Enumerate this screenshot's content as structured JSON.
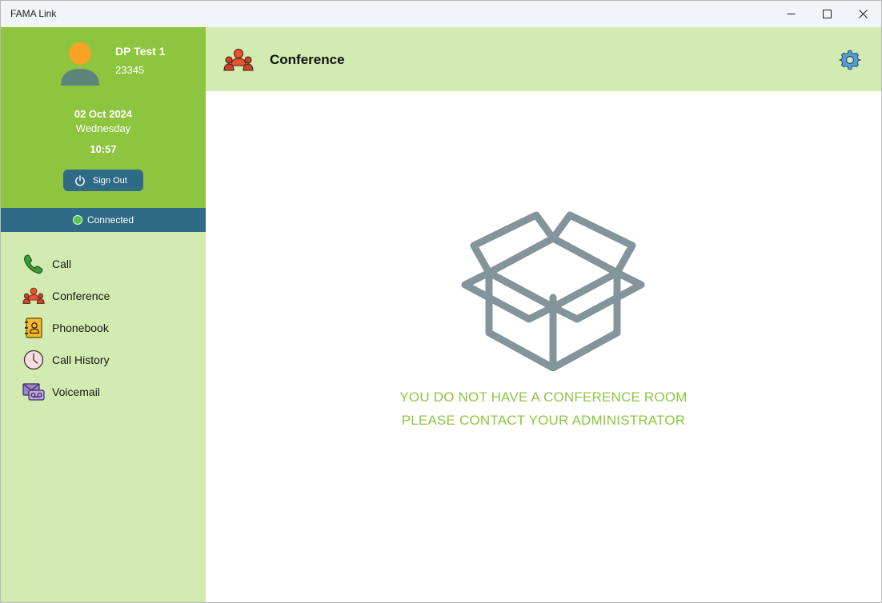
{
  "window": {
    "title": "FAMA Link"
  },
  "colors": {
    "accent_green": "#8dc53f",
    "panel_green": "#d1ebb0",
    "status_blue": "#2f6b87",
    "connected": "#52c64a"
  },
  "user": {
    "name": "DP Test 1",
    "extension": "23345"
  },
  "clock": {
    "date": "02 Oct 2024",
    "weekday": "Wednesday",
    "time": "10:57"
  },
  "signout": {
    "label": "Sign Out",
    "icon": "power-icon"
  },
  "status": {
    "label": "Connected"
  },
  "nav": [
    {
      "label": "Call",
      "icon": "phone-icon"
    },
    {
      "label": "Conference",
      "icon": "conference-icon"
    },
    {
      "label": "Phonebook",
      "icon": "phonebook-icon"
    },
    {
      "label": "Call History",
      "icon": "clock-icon"
    },
    {
      "label": "Voicemail",
      "icon": "voicemail-icon"
    }
  ],
  "header": {
    "title": "Conference",
    "icon": "conference-icon",
    "settings_icon": "gear-icon"
  },
  "main": {
    "empty_icon": "open-box-icon",
    "message_line1": "YOU DO NOT HAVE A CONFERENCE ROOM",
    "message_line2": "PLEASE CONTACT YOUR ADMINISTRATOR"
  }
}
